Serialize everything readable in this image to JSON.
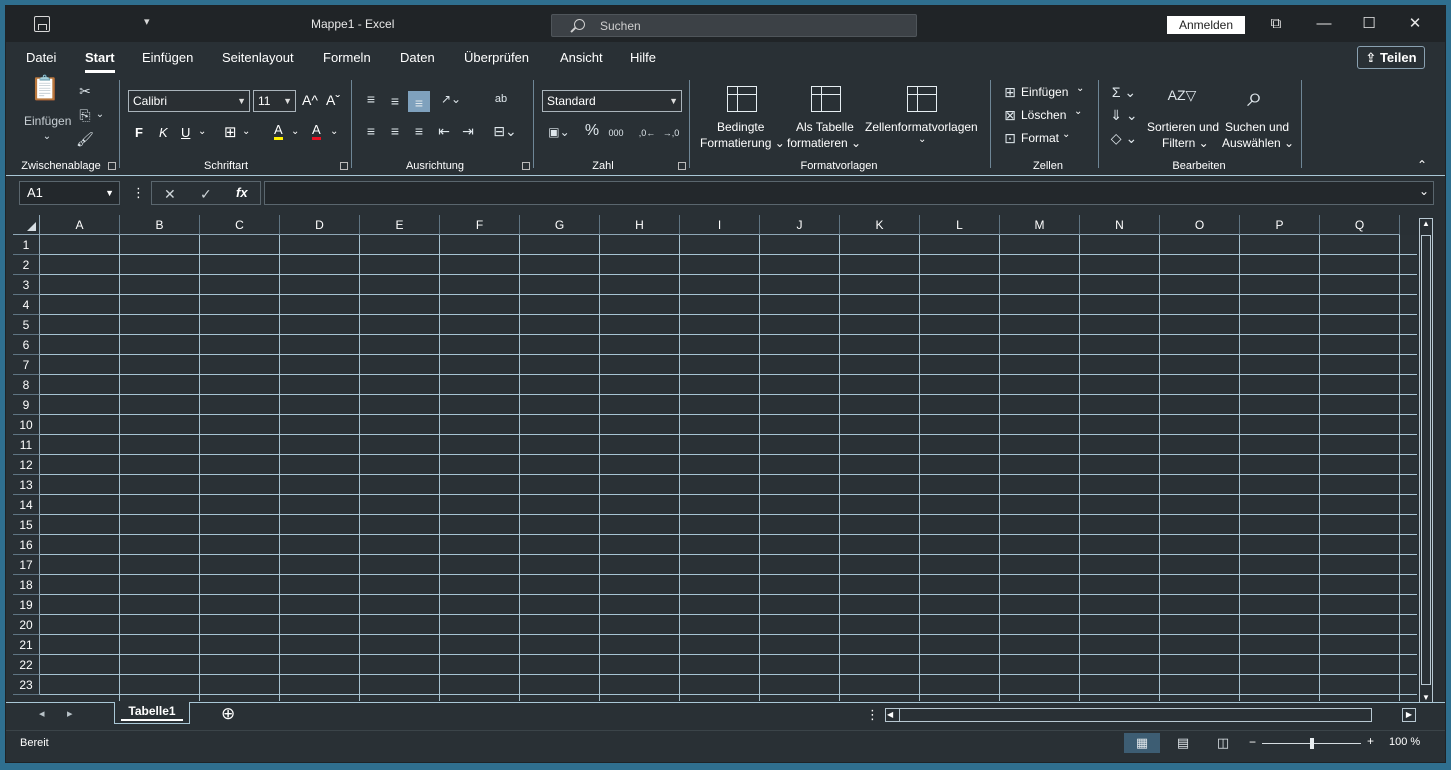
{
  "titlebar": {
    "app_title": "Mappe1  -  Excel",
    "qa_chevron": "▾",
    "search_placeholder": "Suchen",
    "signin_label": "Anmelden",
    "ctrl_restore": "⧉",
    "ctrl_minimize": "—",
    "ctrl_maximize": "☐",
    "ctrl_close": "✕"
  },
  "tabs": [
    "Datei",
    "Start",
    "Einfügen",
    "Seitenlayout",
    "Formeln",
    "Daten",
    "Überprüfen",
    "Ansicht",
    "Hilfe"
  ],
  "active_tab": "Start",
  "share_label": "Teilen",
  "share_icon_glyph": "⇪",
  "ribbon": {
    "clipboard": {
      "label": "Zwischenablage",
      "paste": "Einfügen",
      "paste_icon": "📋",
      "cut_icon": "✂",
      "copy_icon": "⎘",
      "brush_icon": "🖌",
      "dropdown_glyph": "⌄"
    },
    "font": {
      "label": "Schriftart",
      "font_name": "Calibri",
      "font_size": "11",
      "grow_icon": "A^",
      "shrink_icon": "Aˇ",
      "bold": "F",
      "italic": "K",
      "underline": "U",
      "borders_icon": "⊞",
      "fill_icon": "A",
      "color_icon": "A",
      "dropdown_glyph": "⌄",
      "combo_arrow": "▼"
    },
    "alignment": {
      "label": "Ausrichtung",
      "icons": [
        "≡",
        "≡",
        "≡",
        "↗⌄",
        "ab",
        "≡",
        "≡",
        "≡",
        "⇤",
        "⇥",
        "⊟⌄"
      ]
    },
    "number": {
      "label": "Zahl",
      "format": "Standard",
      "icons": [
        "▣⌄",
        "%",
        "000",
        ",0←",
        "→,0"
      ]
    },
    "styles": {
      "label": "Formatvorlagen",
      "conditional_line1": "Bedingte",
      "conditional_line2": "Formatierung ⌄",
      "table_line1": "Als Tabelle",
      "table_line2": "formatieren ⌄",
      "cellstyles": "Zellenformatvorlagen",
      "cellstyles_arrow": "⌄"
    },
    "cells": {
      "label": "Zellen",
      "insert": "Einfügen",
      "delete": "Löschen",
      "format": "Format",
      "insert_icon": "⊞",
      "delete_icon": "⊠",
      "format_icon": "⊡",
      "dropdown_glyph": "⌄"
    },
    "editing": {
      "label": "Bearbeiten",
      "sum_icon": "Σ ⌄",
      "fill_icon": "⇓ ⌄",
      "clear_icon": "◇ ⌄",
      "sort_icon": "AZ▽",
      "find_icon": "⌕",
      "sort_line1": "Sortieren und",
      "sort_line2": "Filtern ⌄",
      "find_line1": "Suchen und",
      "find_line2": "Auswählen ⌄"
    },
    "collapse_icon": "⌃"
  },
  "formula_bar": {
    "namebox_value": "A1",
    "namebox_arrow": "▼",
    "more_icon": "⋮",
    "cancel_icon": "✕",
    "enter_icon": "✓",
    "fx_icon": "fx",
    "formula_value": "",
    "expand_icon": "⌄"
  },
  "columns": [
    "A",
    "B",
    "C",
    "D",
    "E",
    "F",
    "G",
    "H",
    "I",
    "J",
    "K",
    "L",
    "M",
    "N",
    "O",
    "P",
    "Q"
  ],
  "rows": [
    "1",
    "2",
    "3",
    "4",
    "5",
    "6",
    "7",
    "8",
    "9",
    "10",
    "11",
    "12",
    "13",
    "14",
    "15",
    "16",
    "17",
    "18",
    "19",
    "20",
    "21",
    "22",
    "23"
  ],
  "scrollbars": {
    "up_arrow": "▲",
    "down_arrow": "▼",
    "left_arrow": "◀",
    "right_arrow": "▶"
  },
  "sheets": {
    "prev_icon": "◂",
    "next_icon": "▸",
    "active": "Tabelle1",
    "add_icon": "⊕",
    "more_icon": "⋮"
  },
  "status": {
    "ready": "Bereit",
    "view_normal_icon": "▦",
    "view_layout_icon": "▤",
    "view_break_icon": "◫",
    "zoom_minus": "−",
    "zoom_plus": "+",
    "zoom_level": "100 %",
    "zoom_fraction": 0.5
  },
  "colors": {
    "window_bg": "#293035",
    "grid_line": "#a7c3d2",
    "desktop": "#2f6f8f"
  }
}
